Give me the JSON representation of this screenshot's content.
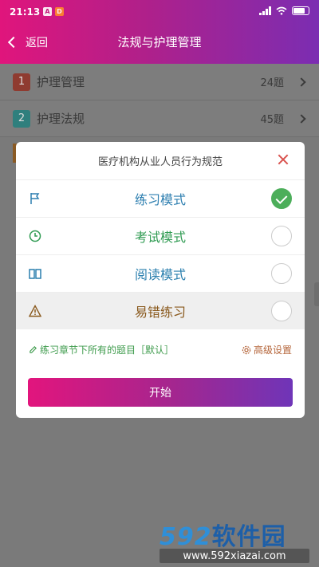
{
  "status_bar": {
    "time": "21:13",
    "notif1": "A",
    "notif2": "D"
  },
  "header": {
    "back_label": "返回",
    "title": "法规与护理管理"
  },
  "list": [
    {
      "num": "1",
      "label": "护理管理",
      "count": "24题"
    },
    {
      "num": "2",
      "label": "护理法规",
      "count": "45题"
    }
  ],
  "modal": {
    "title": "医疗机构从业人员行为规范",
    "modes": [
      {
        "label": "练习模式",
        "icon": "flag-icon",
        "selected": true
      },
      {
        "label": "考试模式",
        "icon": "clock-icon",
        "selected": false
      },
      {
        "label": "阅读模式",
        "icon": "book-icon",
        "selected": false
      },
      {
        "label": "易错练习",
        "icon": "warning-icon",
        "selected": false
      }
    ],
    "scope_text": "练习章节下所有的题目［默认］",
    "advanced_label": "高级设置",
    "start_label": "开始"
  },
  "watermark": {
    "brand_digits": "592",
    "brand_cn": "软件园",
    "url": "www.592xiazai.com"
  },
  "colors": {
    "accent_pink": "#e0157c",
    "accent_purple": "#7b2db2",
    "success_green": "#4cae5a"
  }
}
